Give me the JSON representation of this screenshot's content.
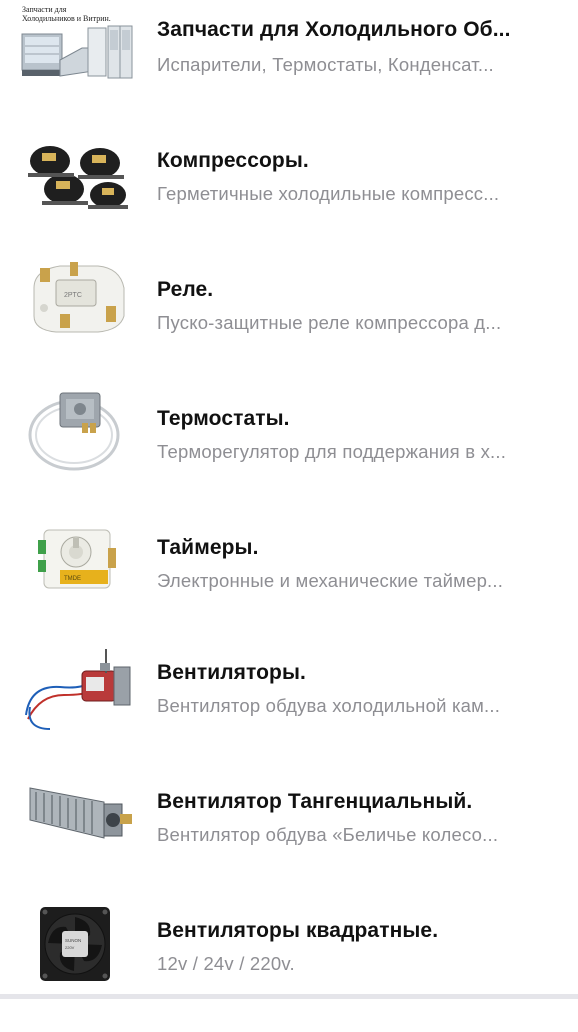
{
  "categories": [
    {
      "title": "Запчасти для Холодильного Об...",
      "subtitle": "Испарители, Термостаты, Конденсат...",
      "image_caption": "Запчасти для\nХолодильников и Витрин.",
      "icon": "refrigeration-showcase-icon"
    },
    {
      "title": "Компрессоры.",
      "subtitle": "Герметичные холодильные компресс...",
      "icon": "compressor-icon"
    },
    {
      "title": "Реле.",
      "subtitle": "Пуско-защитные реле компрессора д...",
      "icon": "relay-icon"
    },
    {
      "title": "Термостаты.",
      "subtitle": "Терморегулятор для поддержания в х...",
      "icon": "thermostat-icon"
    },
    {
      "title": "Таймеры.",
      "subtitle": "Электронные и механические таймер...",
      "icon": "timer-icon"
    },
    {
      "title": "Вентиляторы.",
      "subtitle": "Вентилятор обдува холодильной кам...",
      "icon": "fan-motor-icon"
    },
    {
      "title": "Вентилятор Тангенциальный.",
      "subtitle": "Вентилятор обдува «Беличье колесо...",
      "icon": "tangential-fan-icon"
    },
    {
      "title": "Вентиляторы квадратные.",
      "subtitle": "12v / 24v / 220v.",
      "icon": "square-fan-icon"
    }
  ]
}
